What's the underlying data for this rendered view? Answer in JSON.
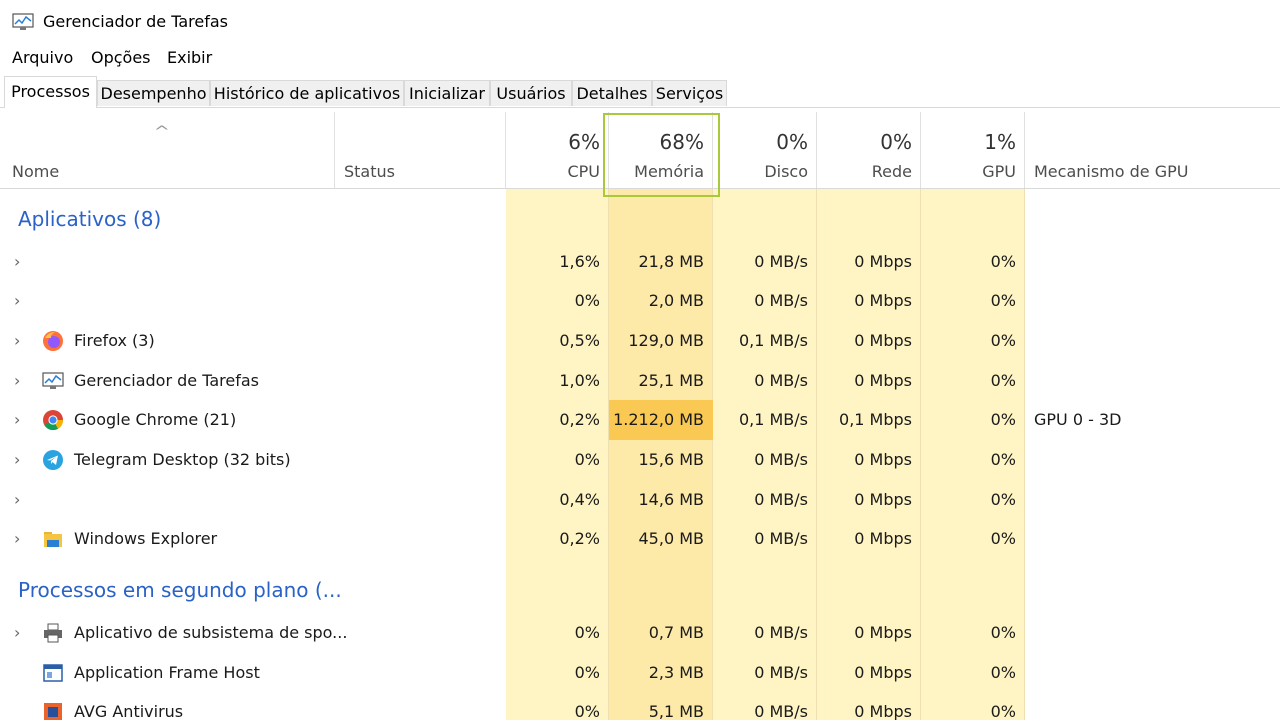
{
  "window": {
    "title": "Gerenciador de Tarefas"
  },
  "menu": {
    "file": "Arquivo",
    "options": "Opções",
    "view": "Exibir"
  },
  "tabs": [
    {
      "label": "Processos"
    },
    {
      "label": "Desempenho"
    },
    {
      "label": "Histórico de aplicativos"
    },
    {
      "label": "Inicializar"
    },
    {
      "label": "Usuários"
    },
    {
      "label": "Detalhes"
    },
    {
      "label": "Serviços"
    }
  ],
  "columns": {
    "name": "Nome",
    "status": "Status",
    "cpu": {
      "pct": "6%",
      "label": "CPU"
    },
    "memory": {
      "pct": "68%",
      "label": "Memória"
    },
    "disk": {
      "pct": "0%",
      "label": "Disco"
    },
    "network": {
      "pct": "0%",
      "label": "Rede"
    },
    "gpu": {
      "pct": "1%",
      "label": "GPU"
    },
    "gpu_engine": "Mecanismo de GPU"
  },
  "groups": {
    "apps": "Aplicativos (8)",
    "background": "Processos em segundo plano (..."
  },
  "apps": [
    {
      "name": "",
      "cpu": "1,6%",
      "mem": "21,8 MB",
      "disk": "0 MB/s",
      "net": "0 Mbps",
      "gpu": "0%",
      "eng": ""
    },
    {
      "name": "",
      "cpu": "0%",
      "mem": "2,0 MB",
      "disk": "0 MB/s",
      "net": "0 Mbps",
      "gpu": "0%",
      "eng": ""
    },
    {
      "name": "Firefox (3)",
      "cpu": "0,5%",
      "mem": "129,0 MB",
      "disk": "0,1 MB/s",
      "net": "0 Mbps",
      "gpu": "0%",
      "eng": ""
    },
    {
      "name": "Gerenciador de Tarefas",
      "cpu": "1,0%",
      "mem": "25,1 MB",
      "disk": "0 MB/s",
      "net": "0 Mbps",
      "gpu": "0%",
      "eng": ""
    },
    {
      "name": "Google Chrome (21)",
      "cpu": "0,2%",
      "mem": "1.212,0 MB",
      "disk": "0,1 MB/s",
      "net": "0,1 Mbps",
      "gpu": "0%",
      "eng": "GPU 0 - 3D"
    },
    {
      "name": "Telegram Desktop (32 bits)",
      "cpu": "0%",
      "mem": "15,6 MB",
      "disk": "0 MB/s",
      "net": "0 Mbps",
      "gpu": "0%",
      "eng": ""
    },
    {
      "name": "",
      "cpu": "0,4%",
      "mem": "14,6 MB",
      "disk": "0 MB/s",
      "net": "0 Mbps",
      "gpu": "0%",
      "eng": ""
    },
    {
      "name": "Windows Explorer",
      "cpu": "0,2%",
      "mem": "45,0 MB",
      "disk": "0 MB/s",
      "net": "0 Mbps",
      "gpu": "0%",
      "eng": ""
    }
  ],
  "background": [
    {
      "name": "Aplicativo de subsistema de spo...",
      "cpu": "0%",
      "mem": "0,7 MB",
      "disk": "0 MB/s",
      "net": "0 Mbps",
      "gpu": "0%"
    },
    {
      "name": "Application Frame Host",
      "cpu": "0%",
      "mem": "2,3 MB",
      "disk": "0 MB/s",
      "net": "0 Mbps",
      "gpu": "0%"
    },
    {
      "name": "AVG Antivirus",
      "cpu": "0%",
      "mem": "5,1 MB",
      "disk": "0 MB/s",
      "net": "0 Mbps",
      "gpu": "0%"
    }
  ],
  "icons": {
    "chevron": "chevron-right-icon"
  },
  "colors": {
    "cpu_bg": "#fff4c4",
    "mem_bg": "#fde9a8",
    "hot": "#f9c954",
    "group_title": "#2a62c7",
    "highlight": "#a8c93a"
  }
}
